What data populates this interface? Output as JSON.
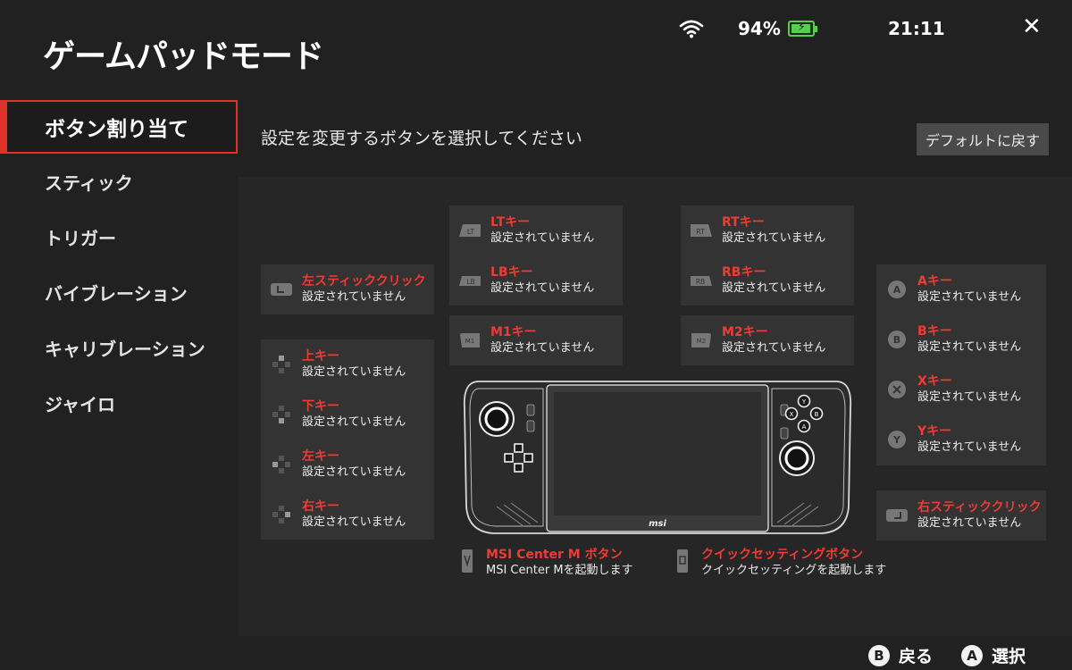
{
  "app": {
    "title": "ゲームパッドモード"
  },
  "status": {
    "battery": "94%",
    "time": "21:11",
    "battery_level": 0.94
  },
  "sidebar": {
    "items": [
      {
        "label": "ボタン割り当て"
      },
      {
        "label": "スティック"
      },
      {
        "label": "トリガー"
      },
      {
        "label": "バイブレーション"
      },
      {
        "label": "キャリブレーション"
      },
      {
        "label": "ジャイロ"
      }
    ]
  },
  "main": {
    "subtitle": "設定を変更するボタンを選択してください",
    "reset_label": "デフォルトに戻す",
    "unset": "設定されていません",
    "left_stick_click": "左スティッククリック",
    "dpad": {
      "up": "上キー",
      "down": "下キー",
      "left": "左キー",
      "right": "右キー"
    },
    "lt": "LTキー",
    "lb": "LBキー",
    "m1": "M1キー",
    "rt": "RTキー",
    "rb": "RBキー",
    "m2": "M2キー",
    "face": {
      "a": "Aキー",
      "b": "Bキー",
      "x": "Xキー",
      "y": "Yキー"
    },
    "right_stick_click": "右スティッククリック",
    "icon_labels": {
      "lt": "LT",
      "lb": "LB",
      "rt": "RT",
      "rb": "RB",
      "a": "A",
      "b": "B",
      "y": "Y"
    },
    "msi_center": {
      "name": "MSI Center M ボタン",
      "desc": "MSI Center Mを起動します"
    },
    "quick_settings": {
      "name": "クイックセッティングボタン",
      "desc": "クイックセッティングを起動します"
    },
    "device_logo": "msi"
  },
  "footer": {
    "back": {
      "glyph": "B",
      "label": "戻る"
    },
    "select": {
      "glyph": "A",
      "label": "選択"
    }
  }
}
